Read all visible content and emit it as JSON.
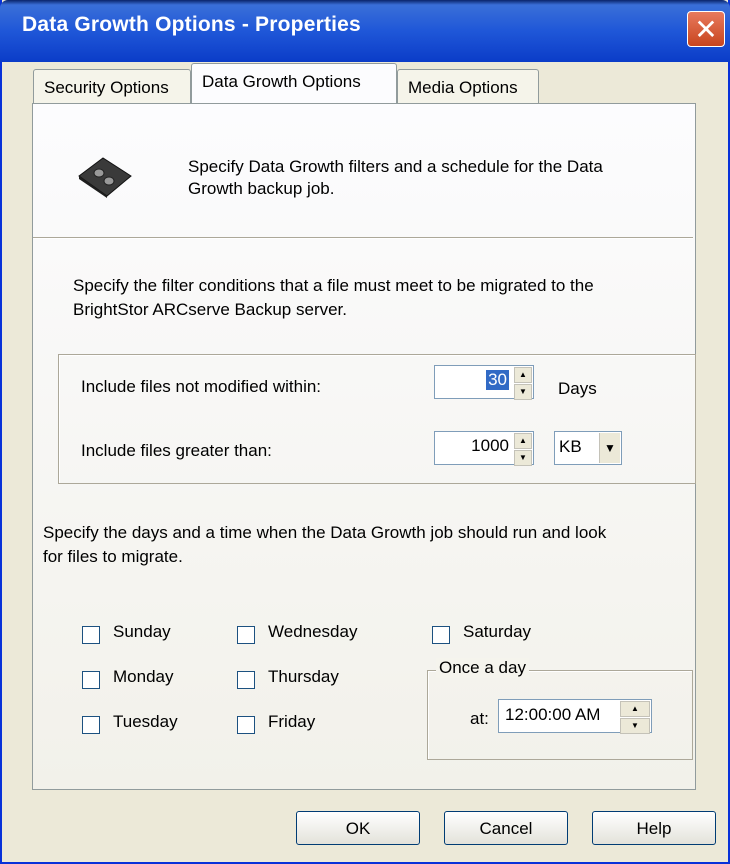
{
  "window": {
    "title": "Data Growth Options - Properties",
    "close_icon": "close-icon"
  },
  "tabs": [
    {
      "label": "Security Options"
    },
    {
      "label": "Data Growth Options",
      "active": true
    },
    {
      "label": "Media Options"
    }
  ],
  "header": {
    "icon": "tape-cartridge-icon",
    "text_line1": "Specify Data Growth filters and a schedule for the Data",
    "text_line2": "Growth backup job."
  },
  "filters": {
    "intro_line1": "Specify the filter conditions that a file must meet to be migrated to the",
    "intro_line2": "BrightStor ARCserve Backup server.",
    "not_modified_label": "Include files not modified within:",
    "not_modified_value": "30",
    "not_modified_unit": "Days",
    "greater_than_label": "Include files greater than:",
    "greater_than_value": "1000",
    "size_unit_selected": "KB"
  },
  "schedule": {
    "intro_line1": "Specify the days and a time when the Data Growth job should run and look",
    "intro_line2": "for files to migrate.",
    "days": [
      "Sunday",
      "Monday",
      "Tuesday",
      "Wednesday",
      "Thursday",
      "Friday",
      "Saturday"
    ],
    "once_a_day_label": "Once a day",
    "at_label": "at:",
    "time_value": "12:00:00 AM"
  },
  "buttons": {
    "ok": "OK",
    "cancel": "Cancel",
    "help": "Help"
  }
}
